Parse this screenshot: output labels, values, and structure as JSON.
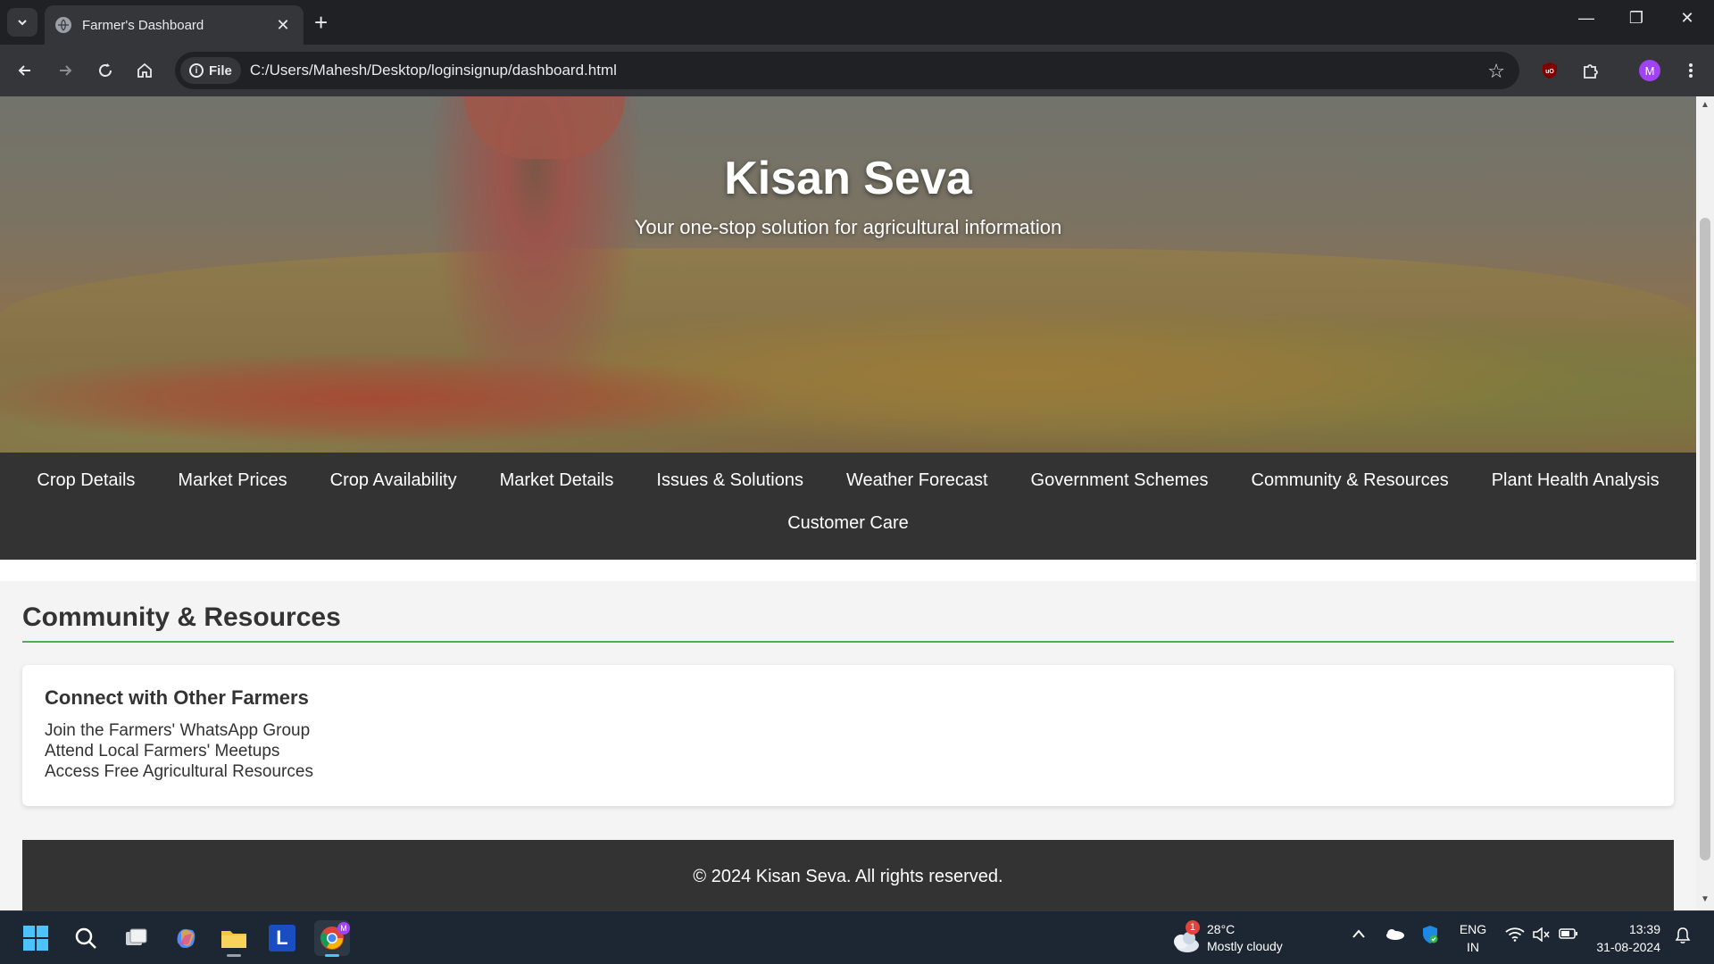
{
  "browser": {
    "tab_title": "Farmer's Dashboard",
    "site_chip_label": "File",
    "url": "C:/Users/Mahesh/Desktop/loginsignup/dashboard.html",
    "profile_initial": "M"
  },
  "hero": {
    "title": "Kisan Seva",
    "subtitle": "Your one-stop solution for agricultural information"
  },
  "nav": {
    "row1": [
      "Crop Details",
      "Market Prices",
      "Crop Availability",
      "Market Details",
      "Issues & Solutions",
      "Weather Forecast",
      "Government Schemes",
      "Community & Resources",
      "Plant Health Analysis"
    ],
    "row2": [
      "Customer Care"
    ]
  },
  "section": {
    "title": "Community & Resources",
    "card": {
      "title": "Connect with Other Farmers",
      "items": [
        "Join the Farmers' WhatsApp Group",
        "Attend Local Farmers' Meetups",
        "Access Free Agricultural Resources"
      ]
    }
  },
  "footer": {
    "text": "© 2024 Kisan Seva. All rights reserved."
  },
  "taskbar": {
    "weather_temp": "28°C",
    "weather_desc": "Mostly cloudy",
    "weather_badge": "1",
    "lang_line1": "ENG",
    "lang_line2": "IN",
    "time": "13:39",
    "date": "31-08-2024",
    "app_letter": "L"
  },
  "colors": {
    "nav_bg": "#333333",
    "accent_rule": "#4caf50",
    "page_bg": "#f4f4f4"
  }
}
